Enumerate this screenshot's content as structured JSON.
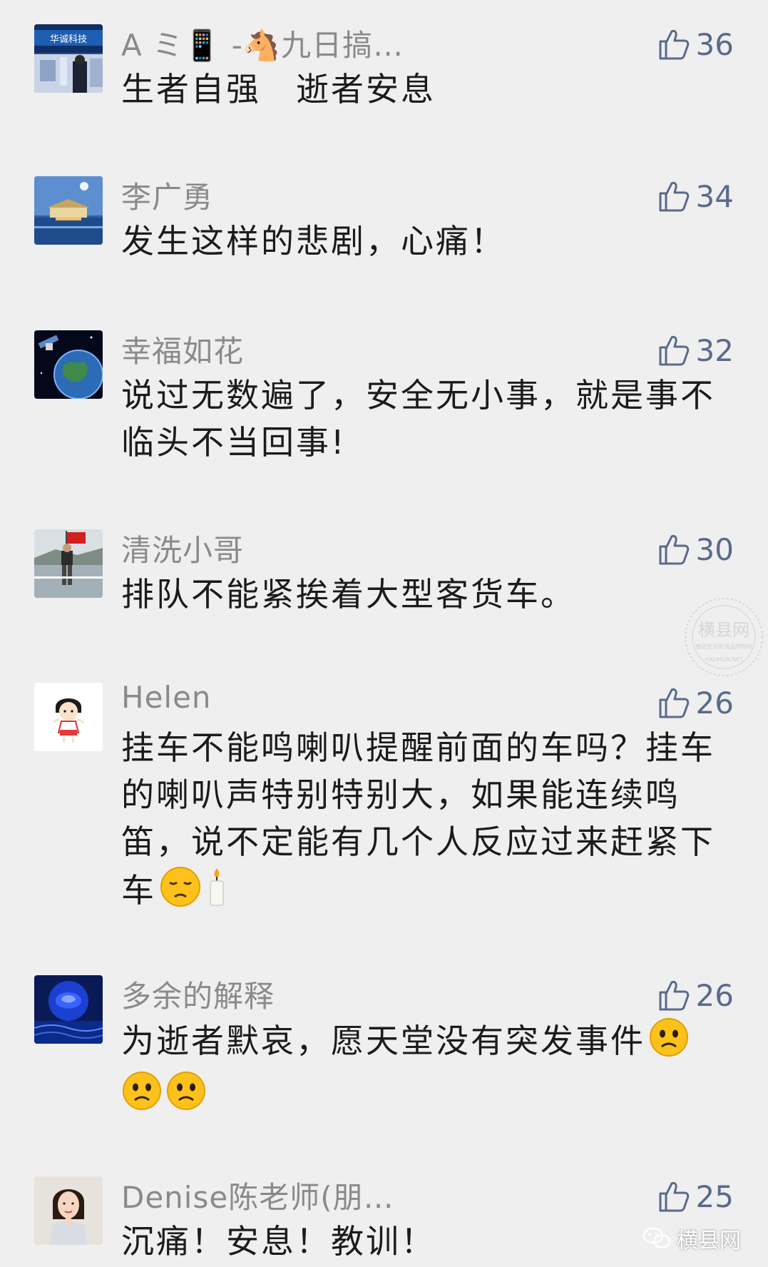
{
  "comments": [
    {
      "nickname": "A ミ📱 -🐴九日搞…",
      "text": "生者自强　逝者安息",
      "likes": "36"
    },
    {
      "nickname": "李广勇",
      "text": "发生这样的悲剧，心痛！",
      "likes": "34"
    },
    {
      "nickname": "幸福如花",
      "text": "说过无数遍了，安全无小事，就是事不临头不当回事!",
      "likes": "32"
    },
    {
      "nickname": "清洗小哥",
      "text": "排队不能紧挨着大型客货车。",
      "likes": "30"
    },
    {
      "nickname": "Helen",
      "text": "挂车不能鸣喇叭提醒前面的车吗？挂车的喇叭声特别特别大，如果能连续鸣笛，说不定能有几个人反应过来赶紧下车",
      "likes": "26"
    },
    {
      "nickname": "多余的解释",
      "text": "为逝者默哀，愿天堂没有突发事件",
      "likes": "26"
    },
    {
      "nickname": "Denise陈老师(朋…",
      "text": "沉痛！安息！教训！",
      "likes": "25"
    }
  ],
  "avatar_text": "华诚科技",
  "watermark": {
    "title": "横县网",
    "subtitle": "横县生活资讯品牌网站",
    "url": "HXLIHUA.NET"
  },
  "footer": {
    "logo_text": "横县网"
  },
  "colors": {
    "background": "#efefef",
    "nickname": "#8a8a8a",
    "text": "#1b1b1b",
    "like": "#5a6a8a"
  },
  "icons": {
    "like": "thumbs-up-icon",
    "footer": "wechat-icon"
  }
}
